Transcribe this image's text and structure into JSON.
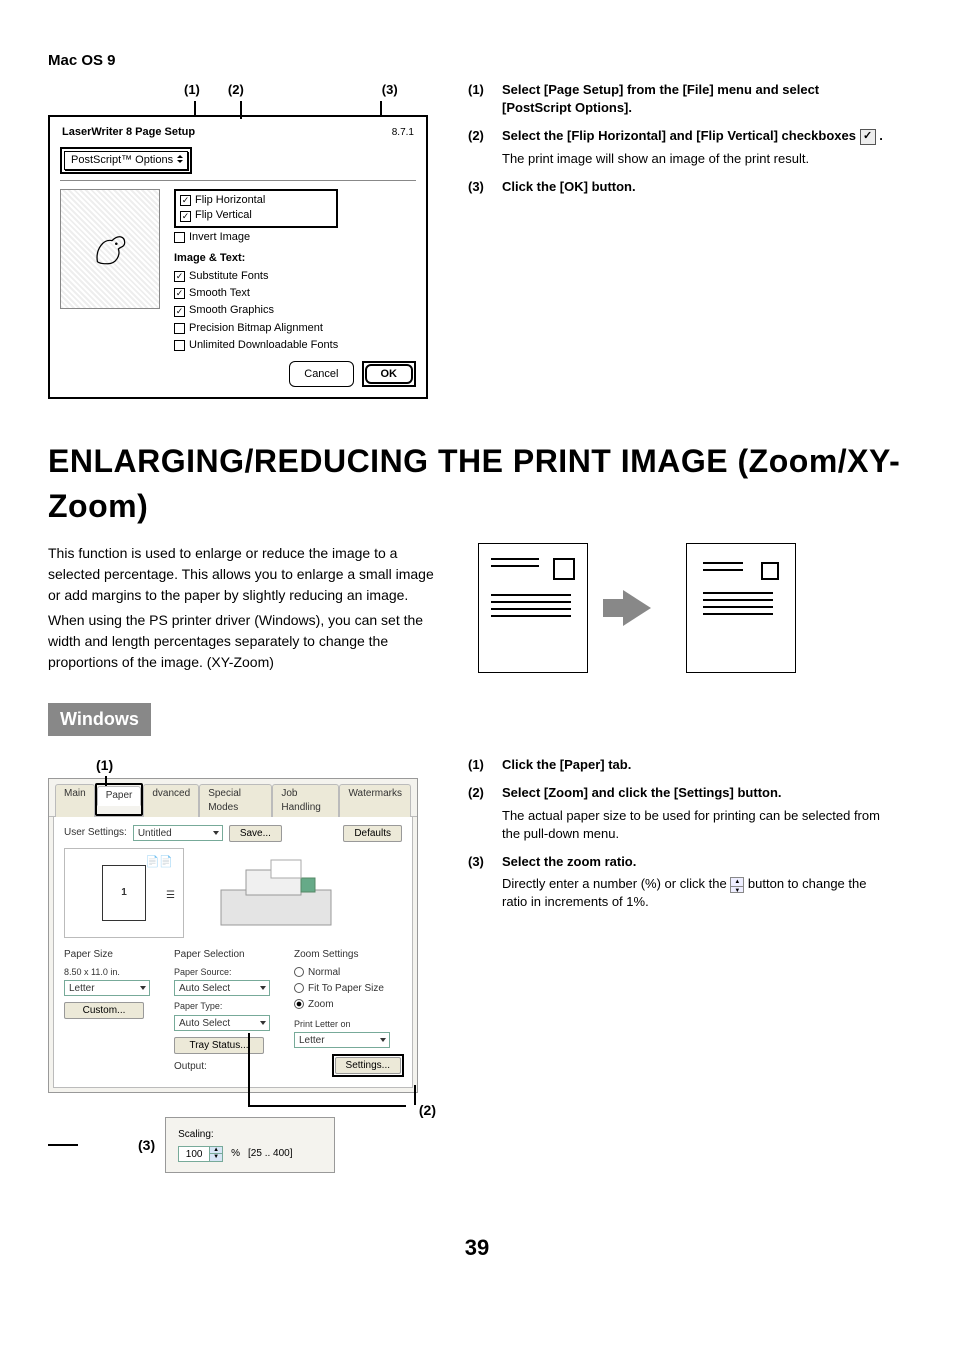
{
  "macos": {
    "heading": "Mac OS 9",
    "callouts": {
      "c1": "(1)",
      "c2": "(2)",
      "c3": "(3)"
    },
    "dialog": {
      "title": "LaserWriter 8 Page Setup",
      "version": "8.7.1",
      "dropdown": "PostScript™ Options",
      "opts": {
        "flip_h": "Flip Horizontal",
        "flip_v": "Flip Vertical",
        "invert": "Invert Image",
        "group": "Image & Text:",
        "sub_fonts": "Substitute Fonts",
        "smooth_text": "Smooth Text",
        "smooth_gfx": "Smooth Graphics",
        "precision": "Precision Bitmap Alignment",
        "unlimited": "Unlimited Downloadable Fonts"
      },
      "cancel": "Cancel",
      "ok": "OK"
    },
    "steps": {
      "s1": {
        "n": "(1)",
        "t": "Select [Page Setup] from the [File] menu and select [PostScript Options]."
      },
      "s2": {
        "n": "(2)",
        "t1": "Select the [Flip Horizontal] and [Flip Vertical] checkboxes ",
        "t2": " .",
        "sub": "The print image will show an image of the print result."
      },
      "s3": {
        "n": "(3)",
        "t": "Click the [OK] button."
      }
    }
  },
  "main": {
    "title": "ENLARGING/REDUCING THE PRINT IMAGE (Zoom/XY-Zoom)",
    "intro1": "This function is used to enlarge or reduce the image to a selected percentage. This allows you to enlarge a small image or add margins to the paper by slightly reducing an image.",
    "intro2": "When using the PS printer driver (Windows), you can set the width and length percentages separately to change the proportions of the image. (XY-Zoom)"
  },
  "windows": {
    "tag": "Windows",
    "callouts": {
      "c1": "(1)",
      "c2": "(2)",
      "c3": "(3)"
    },
    "tabs": {
      "main": "Main",
      "paper": "Paper",
      "adv": "dvanced",
      "sp": "Special Modes",
      "job": "Job Handling",
      "wm": "Watermarks"
    },
    "panel": {
      "user_settings_label": "User Settings:",
      "user_settings_value": "Untitled",
      "save": "Save...",
      "defaults": "Defaults",
      "paper_size": "Paper Size",
      "dims": "8.50 x 11.0 in.",
      "letter": "Letter",
      "custom": "Custom...",
      "paper_selection": "Paper Selection",
      "paper_source": "Paper Source:",
      "auto_select": "Auto Select",
      "paper_type": "Paper Type:",
      "tray_status": "Tray Status...",
      "output": "Output:",
      "zoom_settings": "Zoom Settings",
      "normal": "Normal",
      "fit": "Fit To Paper Size",
      "zoom": "Zoom",
      "print_letter_on": "Print Letter on",
      "settings": "Settings..."
    },
    "popup": {
      "scaling": "Scaling:",
      "value": "100",
      "pct": "%",
      "range": "[25 .. 400]"
    },
    "steps": {
      "s1": {
        "n": "(1)",
        "t": "Click the [Paper] tab."
      },
      "s2": {
        "n": "(2)",
        "t": "Select [Zoom] and click the [Settings] button.",
        "sub": "The actual paper size to be used for printing can be selected from the pull-down menu."
      },
      "s3": {
        "n": "(3)",
        "t": "Select the zoom ratio.",
        "sub1": "Directly enter a number (%) or click the ",
        "sub2": " button to change the ratio in increments of 1%."
      }
    }
  },
  "page_number": "39"
}
